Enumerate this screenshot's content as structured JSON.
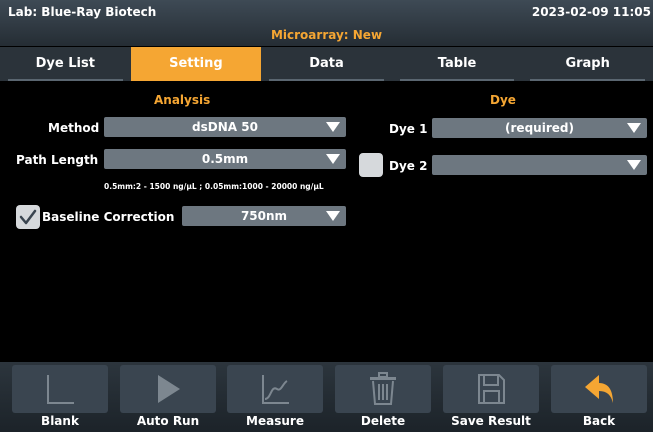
{
  "header": {
    "lab": "Lab: Blue-Ray Biotech",
    "datetime": "2023-02-09 11:05",
    "subtitle": "Microarray: New"
  },
  "tabs": [
    "Dye List",
    "Setting",
    "Data",
    "Table",
    "Graph"
  ],
  "active_tab": "Setting",
  "analysis": {
    "title": "Analysis",
    "method_label": "Method",
    "method_value": "dsDNA 50",
    "path_label": "Path Length",
    "path_value": "0.5mm",
    "path_hint": "0.5mm:2 - 1500 ng/µL ; 0.05mm:1000 - 20000 ng/µL",
    "baseline_label": "Baseline Correction",
    "baseline_checked": true,
    "baseline_value": "750nm"
  },
  "dye": {
    "title": "Dye",
    "dye1_label": "Dye 1",
    "dye1_value": "(required)",
    "dye2_label": "Dye 2",
    "dye2_checked": false,
    "dye2_value": ""
  },
  "toolbar": {
    "blank": "Blank",
    "auto_run": "Auto Run",
    "measure": "Measure",
    "delete": "Delete",
    "save_result": "Save Result",
    "back": "Back"
  },
  "colors": {
    "accent": "#f5a633",
    "dropdown": "#6d7780",
    "button": "#3a4550"
  }
}
